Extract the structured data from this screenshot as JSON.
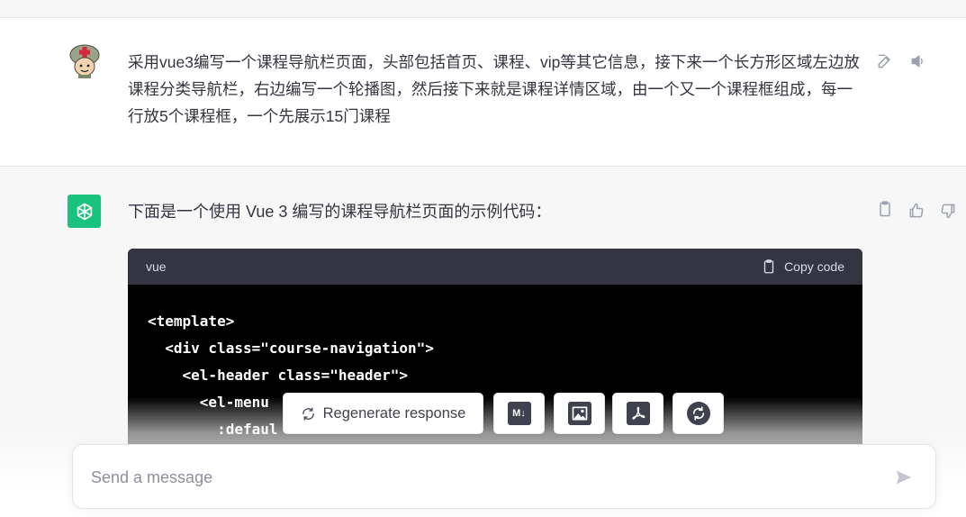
{
  "user_message": {
    "text": "采用vue3编写一个课程导航栏页面，头部包括首页、课程、vip等其它信息，接下来一个长方形区域左边放课程分类导航栏，右边编写一个轮播图，然后接下来就是课程详情区域，由一个又一个课程框组成，每一行放5个课程框，一个先展示15门课程",
    "avatar_icon": "soldier-avatar",
    "actions": [
      "edit-icon",
      "speaker-icon"
    ]
  },
  "assistant_message": {
    "text": "下面是一个使用 Vue 3 编写的课程导航栏页面的示例代码：",
    "avatar_icon": "openai-logo",
    "avatar_color": "#19c37d",
    "actions": [
      "clipboard-icon",
      "thumbs-up-icon",
      "thumbs-down-icon"
    ],
    "code": {
      "language": "vue",
      "copy_label": "Copy code",
      "lines": [
        "<template>",
        "  <div class=\"course-navigation\">",
        "    <el-header class=\"header\">",
        "      <el-menu",
        "        :defaul"
      ]
    }
  },
  "action_bar": {
    "regenerate_label": "Regenerate response",
    "tools": [
      {
        "icon": "markdown-icon",
        "glyph": "M↓"
      },
      {
        "icon": "image-icon"
      },
      {
        "icon": "pdf-icon"
      },
      {
        "icon": "sync-icon"
      }
    ]
  },
  "composer": {
    "placeholder": "Send a message",
    "value": ""
  },
  "colors": {
    "assistant_bg": "#f7f7f8",
    "code_header_bg": "#343541",
    "code_bg": "#000000",
    "accent": "#19c37d"
  }
}
